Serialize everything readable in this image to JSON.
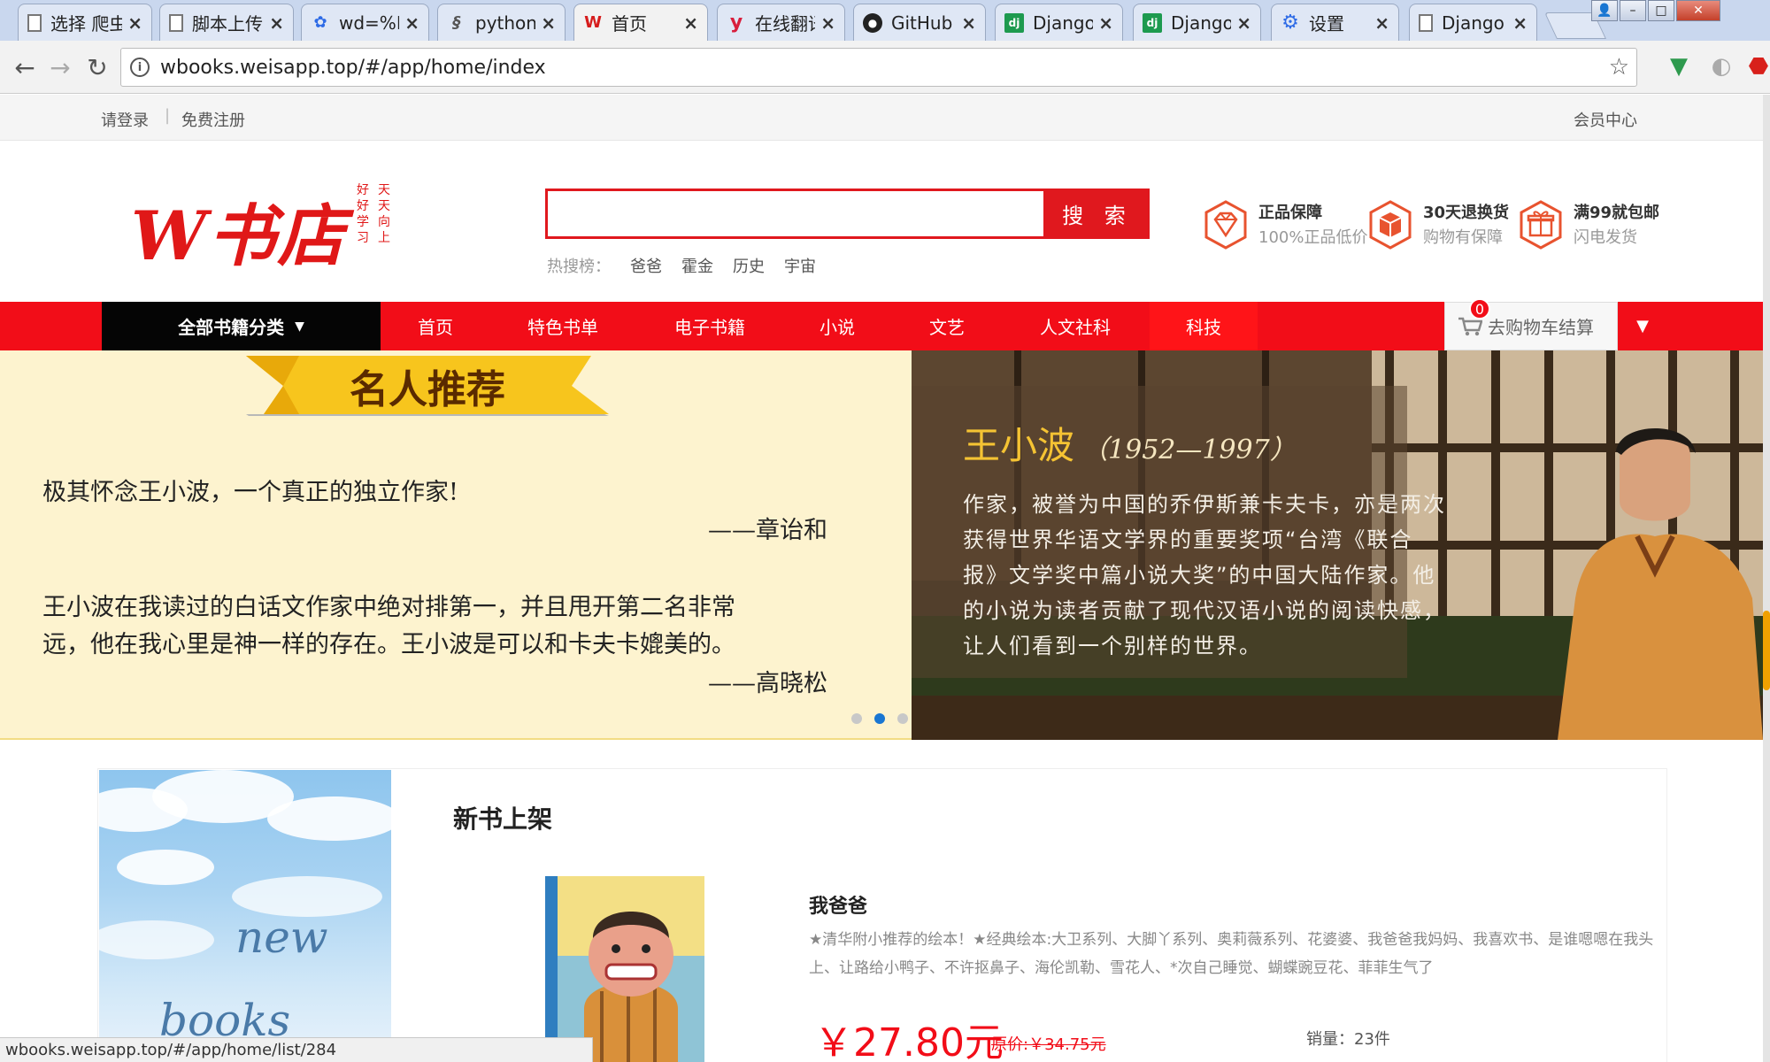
{
  "browser": {
    "tabs": [
      {
        "title": "选择 爬虫",
        "icon": "document-icon"
      },
      {
        "title": "脚本上传",
        "icon": "document-icon"
      },
      {
        "title": "wd=%E",
        "icon": "baidu-paw-icon"
      },
      {
        "title": "python",
        "icon": "python-icon"
      },
      {
        "title": "首页",
        "icon": "weisapp-w-icon",
        "active": true
      },
      {
        "title": "在线翻译",
        "icon": "youdao-y-icon"
      },
      {
        "title": "GitHub",
        "icon": "github-icon"
      },
      {
        "title": "Django",
        "icon": "django-icon"
      },
      {
        "title": "Django",
        "icon": "django-icon"
      },
      {
        "title": "设置",
        "icon": "gear-icon"
      },
      {
        "title": "Django",
        "icon": "document-icon"
      }
    ],
    "url": "wbooks.weisapp.top/#/app/home/index",
    "status_url": "wbooks.weisapp.top/#/app/home/list/284",
    "accent": "#c9d7ee"
  },
  "site_top": {
    "login": "请登录",
    "separator": "|",
    "register": "免费注册",
    "member_center": "会员中心"
  },
  "header": {
    "logo": "W书店",
    "slogan_col1": "好好学习",
    "slogan_col2": "天天向上",
    "search_button": "搜 索",
    "search_value": "",
    "hot_label": "热搜榜：",
    "hot_words": [
      "爸爸",
      "霍金",
      "历史",
      "宇宙"
    ],
    "promos": [
      {
        "title": "正品保障",
        "subtitle": "100%正品低价",
        "icon": "diamond-icon"
      },
      {
        "title": "30天退换货",
        "subtitle": "购物有保障",
        "icon": "box-icon"
      },
      {
        "title": "满99就包邮",
        "subtitle": "闪电发货",
        "icon": "gift-icon"
      }
    ],
    "brand_color": "#e0181e"
  },
  "nav": {
    "all_categories": "全部书籍分类",
    "items": [
      "首页",
      "特色书单",
      "电子书籍",
      "小说",
      "文艺",
      "人文社科",
      "科技"
    ],
    "cart_label": "去购物车结算",
    "cart_count": "0"
  },
  "banner": {
    "ribbon": "名人推荐",
    "quote1": "极其怀念王小波，一个真正的独立作家!",
    "attrib1": "——章诒和",
    "quote2_line1": "王小波在我读过的白话文作家中绝对排第一，并且甩开第二名非常",
    "quote2_line2": "远，他在我心里是神一样的存在。王小波是可以和卡夫卡媲美的。",
    "attrib2": "——高晓松",
    "bio_name": "王小波",
    "bio_years": "（1952—1997）",
    "bio_line1": "作家，被誉为中国的乔伊斯兼卡夫卡，亦是两次",
    "bio_line2": "获得世界华语文学界的重要奖项“台湾《联合",
    "bio_line3": "报》文学奖中篇小说大奖”的中国大陆作家。他",
    "bio_line4": "的小说为读者贡献了现代汉语小说的阅读快感，",
    "bio_line5": "让人们看到一个别样的世界。",
    "carousel_active": 2,
    "carousel_count": 3
  },
  "new_books": {
    "section_title": "新书上架",
    "side_word1": "new",
    "side_word2": "books",
    "book": {
      "name": "我爸爸",
      "desc": "★清华附小推荐的绘本！★经典绘本:大卫系列、大脚丫系列、奥莉薇系列、花婆婆、我爸爸我妈妈、我喜欢书、是谁嗯嗯在我头上、让路给小鸭子、不许抠鼻子、海伦凯勒、雪花人、*次自己睡觉、蝴蝶豌豆花、菲菲生气了",
      "price": "￥27.80元",
      "old_price": "原价:￥34.75元",
      "sales": "销量：23件"
    }
  }
}
